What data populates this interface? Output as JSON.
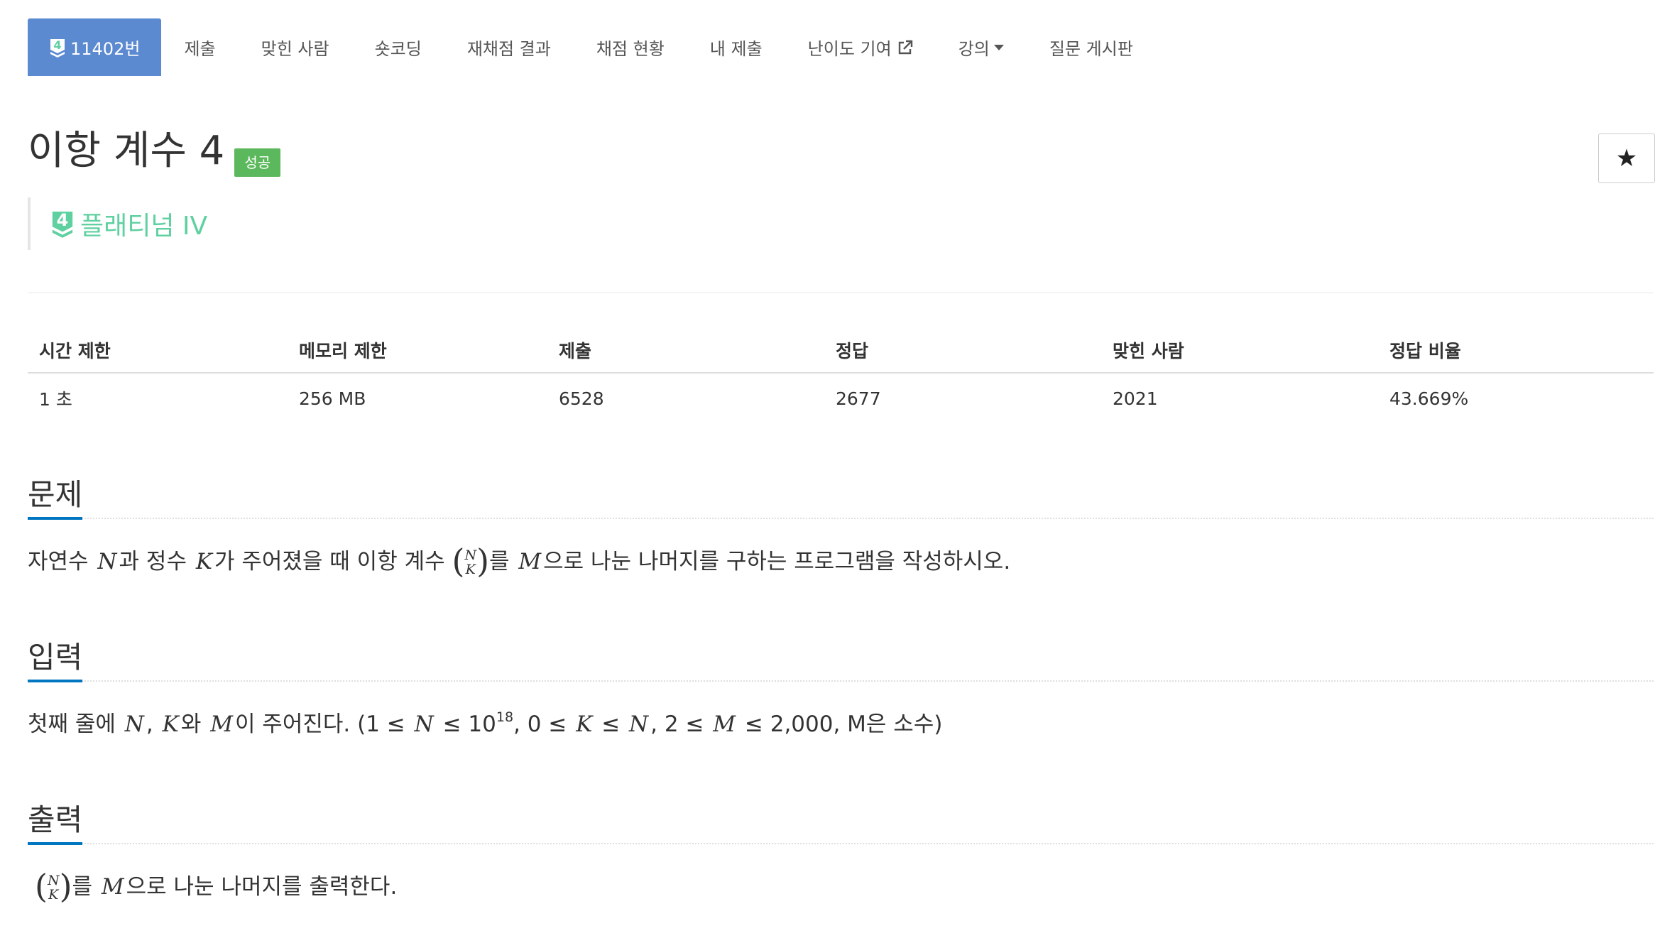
{
  "tabs": [
    {
      "label": "11402번",
      "icon": "platinum-4-tier-icon",
      "active": true
    },
    {
      "label": "제출"
    },
    {
      "label": "맞힌 사람"
    },
    {
      "label": "숏코딩"
    },
    {
      "label": "재채점 결과"
    },
    {
      "label": "채점 현황"
    },
    {
      "label": "내 제출"
    },
    {
      "label": "난이도 기여",
      "icon": "external-link-icon"
    },
    {
      "label": "강의",
      "icon": "caret-down-icon"
    },
    {
      "label": "질문 게시판"
    }
  ],
  "problem": {
    "title": "이항 계수 4",
    "status_badge": "성공",
    "star_label": "★",
    "tier_number": "4",
    "tier_label": "플래티넘 IV"
  },
  "stats": {
    "headers": [
      "시간 제한",
      "메모리 제한",
      "제출",
      "정답",
      "맞힌 사람",
      "정답 비율"
    ],
    "values": [
      "1 초",
      "256 MB",
      "6528",
      "2677",
      "2021",
      "43.669%"
    ]
  },
  "sections": {
    "problem": {
      "title": "문제",
      "text": {
        "p1": "자연수 ",
        "N": "N",
        "p2": "과 정수 ",
        "K": "K",
        "p3": "가 주어졌을 때 이항 계수 ",
        "p4": "를 ",
        "M": "M",
        "p5": "으로 나눈 나머지를 구하는 프로그램을 작성하시오."
      }
    },
    "input": {
      "title": "입력",
      "text": {
        "p1": "첫째 줄에 ",
        "N": "N",
        "comma": ", ",
        "K": "K",
        "p2": "와 ",
        "M": "M",
        "p3": "이 주어진다. (1 ≤ ",
        "N2": "N",
        "p4": " ≤ 10",
        "exp": "18",
        "p5": ", 0 ≤ ",
        "K2": "K",
        "p6": " ≤ ",
        "N3": "N",
        "p7": ", 2 ≤ ",
        "M2": "M",
        "p8": " ≤ 2,000, M은 소수)"
      }
    },
    "output": {
      "title": "출력",
      "text": {
        "p1": "를 ",
        "M": "M",
        "p2": "으로 나눈 나머지를 출력한다."
      }
    }
  },
  "binom": {
    "top": "N",
    "bottom": "K",
    "open": "(",
    "close": ")"
  },
  "colors": {
    "tab_active": "#5b8ad0",
    "success": "#5cb85c",
    "platinum": "#5fd0a0",
    "section_underline": "#0076c0"
  }
}
